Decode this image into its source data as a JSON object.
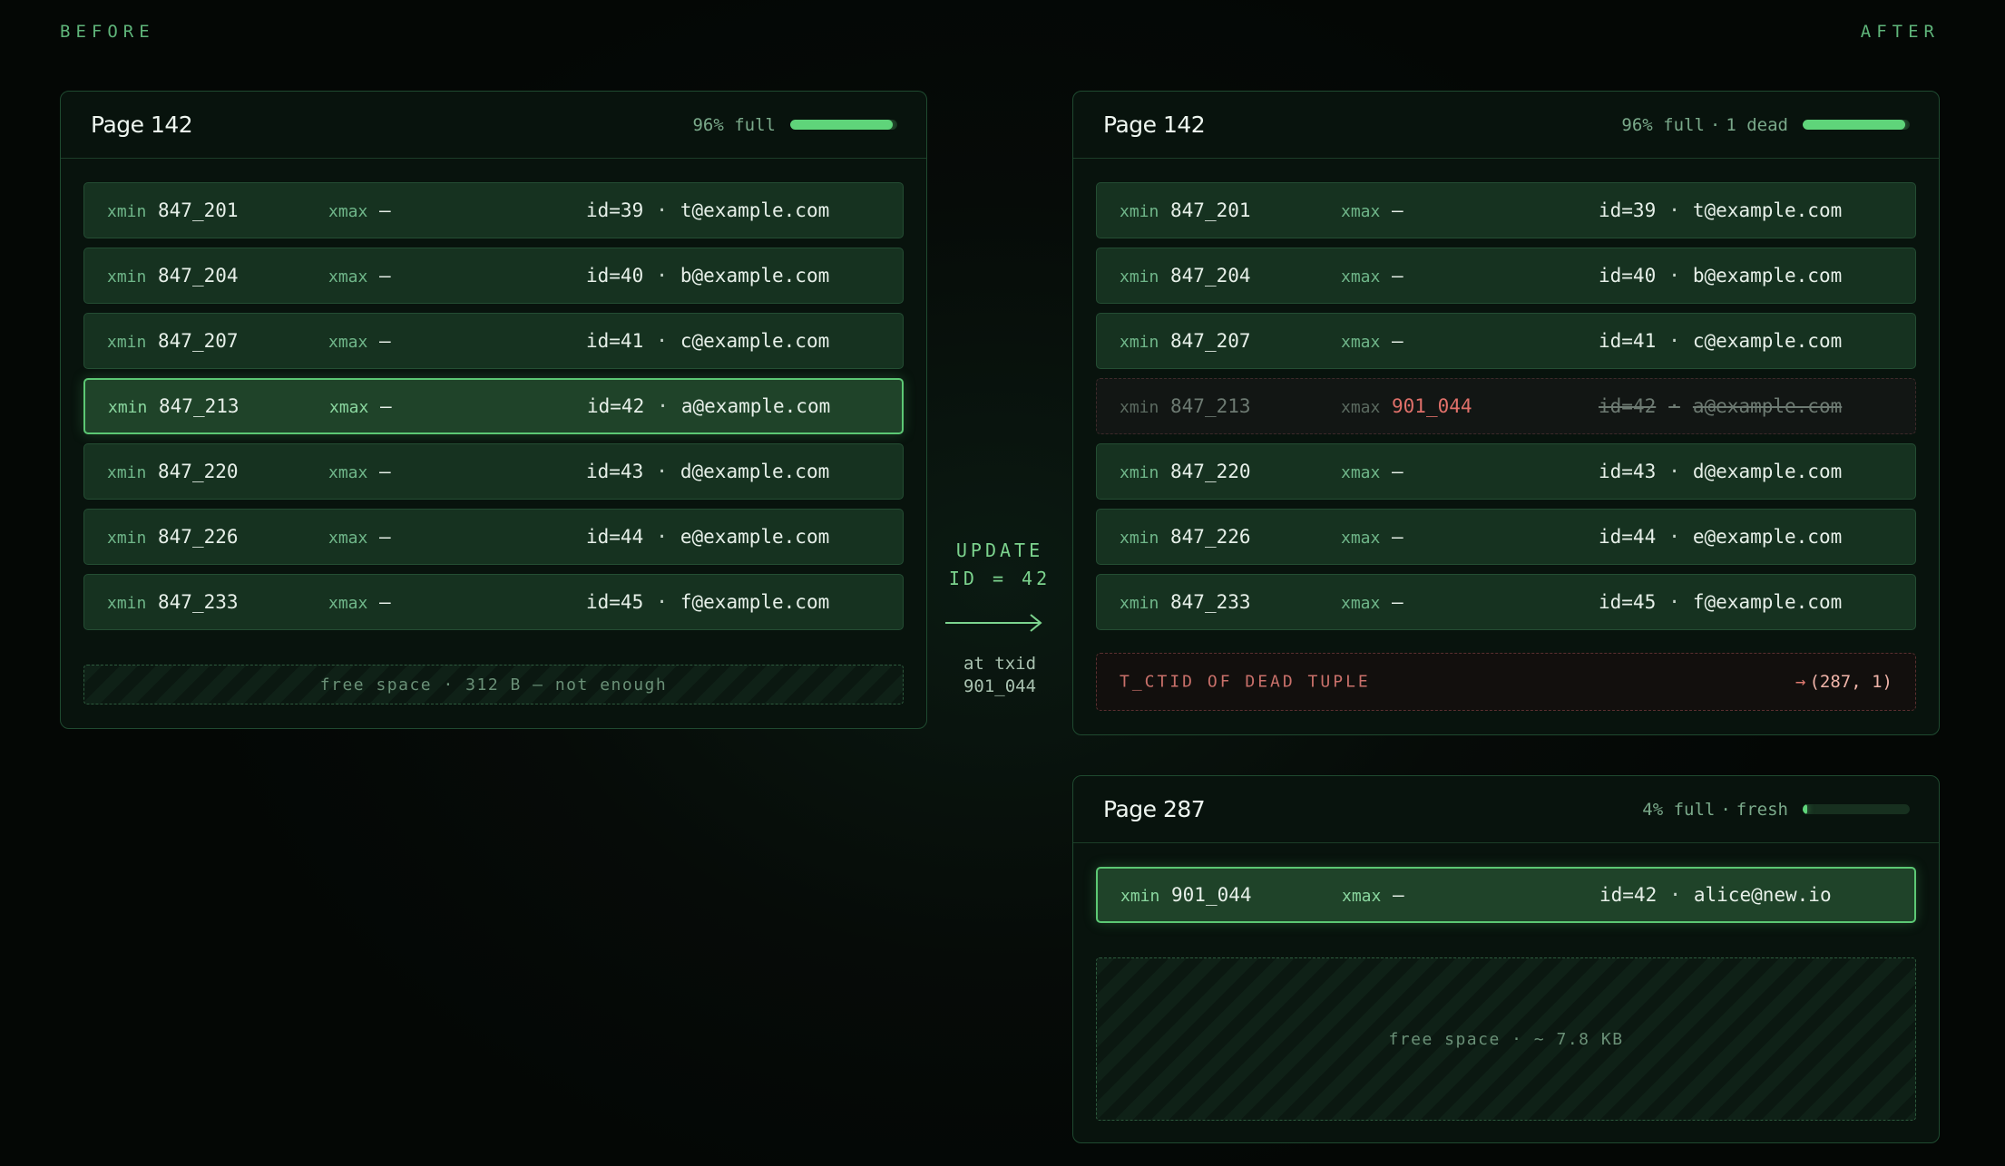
{
  "labels": {
    "before": "BEFORE",
    "after": "AFTER"
  },
  "operation": {
    "line1": "UPDATE",
    "line2": "ID = 42",
    "txid_label": "at txid",
    "txid": "901_044"
  },
  "keys": {
    "xmin": "xmin",
    "xmax": "xmax",
    "dash": "—",
    "dot": "·"
  },
  "before": {
    "title": "Page 142",
    "fill_text": "96% full",
    "fill": 0.96,
    "rows": [
      {
        "xmin": "847_201",
        "xmax": "—",
        "id": "id=39",
        "email": "t@example.com"
      },
      {
        "xmin": "847_204",
        "xmax": "—",
        "id": "id=40",
        "email": "b@example.com"
      },
      {
        "xmin": "847_207",
        "xmax": "—",
        "id": "id=41",
        "email": "c@example.com"
      },
      {
        "xmin": "847_213",
        "xmax": "—",
        "id": "id=42",
        "email": "a@example.com",
        "state": "target"
      },
      {
        "xmin": "847_220",
        "xmax": "—",
        "id": "id=43",
        "email": "d@example.com"
      },
      {
        "xmin": "847_226",
        "xmax": "—",
        "id": "id=44",
        "email": "e@example.com"
      },
      {
        "xmin": "847_233",
        "xmax": "—",
        "id": "id=45",
        "email": "f@example.com"
      }
    ],
    "free_space": "free space · 312 B — not enough"
  },
  "after_142": {
    "title": "Page 142",
    "fill_text": "96% full",
    "fill_extra": "1 dead",
    "fill": 0.96,
    "rows": [
      {
        "xmin": "847_201",
        "xmax": "—",
        "id": "id=39",
        "email": "t@example.com"
      },
      {
        "xmin": "847_204",
        "xmax": "—",
        "id": "id=40",
        "email": "b@example.com"
      },
      {
        "xmin": "847_207",
        "xmax": "—",
        "id": "id=41",
        "email": "c@example.com"
      },
      {
        "xmin": "847_213",
        "xmax": "901_044",
        "id": "id=42",
        "email": "a@example.com",
        "state": "dead"
      },
      {
        "xmin": "847_220",
        "xmax": "—",
        "id": "id=43",
        "email": "d@example.com"
      },
      {
        "xmin": "847_226",
        "xmax": "—",
        "id": "id=44",
        "email": "e@example.com"
      },
      {
        "xmin": "847_233",
        "xmax": "—",
        "id": "id=45",
        "email": "f@example.com"
      }
    ],
    "ctid_label": "T_CTID OF DEAD TUPLE",
    "ctid_arrow": "→",
    "ctid_value": "(287, 1)"
  },
  "after_287": {
    "title": "Page 287",
    "fill_text": "4% full",
    "fill_extra": "fresh",
    "fill": 0.04,
    "rows": [
      {
        "xmin": "901_044",
        "xmax": "—",
        "id": "id=42",
        "email": "alice@new.io",
        "state": "new"
      }
    ],
    "free_space": "free space · ~ 7.8 KB"
  },
  "colors": {
    "accent": "#5fd47a",
    "dead": "#e0706a",
    "background": "#060b08"
  }
}
